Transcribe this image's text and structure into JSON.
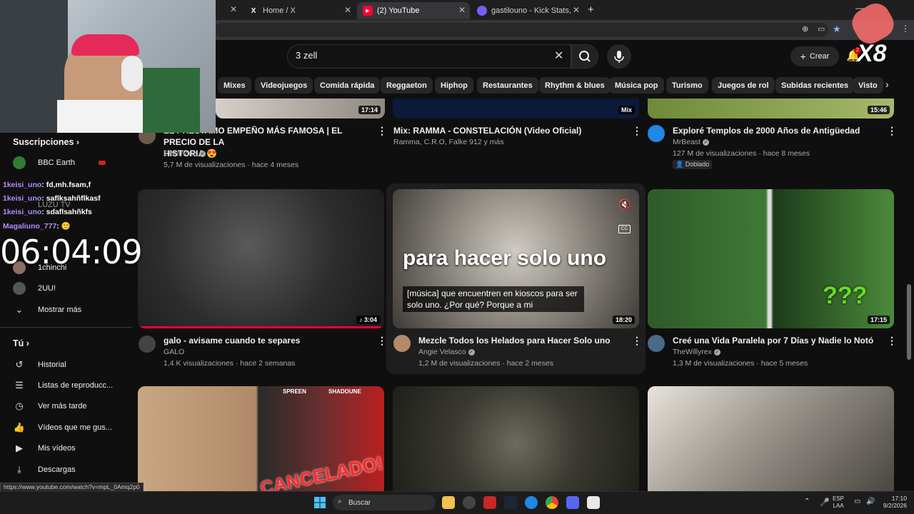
{
  "browser": {
    "tabs": [
      {
        "label": "Home / X"
      },
      {
        "label": "(2) YouTube"
      },
      {
        "label": "gastilouno - Kick Stats, Analytic"
      }
    ],
    "status_url": "https://www.youtube.com/watch?v=mpL_0Amq2p0"
  },
  "header": {
    "search_value": "3 zell",
    "create_label": "Crear",
    "notif_count": "2"
  },
  "chips": [
    "Mixes",
    "Videojuegos",
    "Comida rápida",
    "Reggaeton",
    "Hiphop",
    "Restaurantes",
    "Rhythm & blues",
    "Música pop",
    "Turismo",
    "Juegos de rol",
    "Subidas recientes",
    "Visto"
  ],
  "sidebar": {
    "subs_title": "Suscripciones",
    "subs": [
      {
        "label": "BBC Earth"
      },
      {
        "label": "LUZU TV"
      },
      {
        "label": "1chinchi"
      },
      {
        "label": "2UU!"
      }
    ],
    "show_more": "Mostrar más",
    "you_title": "Tú",
    "you_items": [
      {
        "label": "Historial",
        "icon": "history-icon"
      },
      {
        "label": "Listas de reproducc...",
        "icon": "playlist-icon"
      },
      {
        "label": "Ver más tarde",
        "icon": "clock-icon"
      },
      {
        "label": "Vídeos que me gus...",
        "icon": "thumbs-up-icon"
      },
      {
        "label": "Mis vídeos",
        "icon": "my-videos-icon"
      },
      {
        "label": "Descargas",
        "icon": "download-icon"
      }
    ]
  },
  "overlay": {
    "chat": [
      {
        "user": "1keisi_uno",
        "msg": ": fd,mh.fsam,f"
      },
      {
        "user": "1keisi_uno",
        "msg": ": saflksahñflkasf"
      },
      {
        "user": "1keisi_uno",
        "msg": ": sdaflsahñkfs"
      },
      {
        "user": "Magaliuno_777",
        "msg": ": 🙂"
      }
    ],
    "timer": "06:04:09",
    "multiplier": "X8"
  },
  "videos": [
    {
      "title": "EL PRESTAMO EMPEÑO MÁS FAMOSA | EL PRECIO DE LA",
      "title2": "HISTORIA 😍",
      "channel": "ElMariana",
      "meta": "5,7 M de visualizaciones · hace 4 meses",
      "duration": "17:14"
    },
    {
      "title": "Mix: RAMMA - CONSTELACIÓN (Video Oficial)",
      "channel": "Ramma, C.R.O, Falke 912 y más",
      "meta": "",
      "duration": "Mix"
    },
    {
      "title": "Exploré Templos de 2000 Años de Antigüedad",
      "channel": "MrBeast",
      "meta": "127 M de visualizaciones · hace 8 meses",
      "badge": "Doblado",
      "duration": "15:46"
    },
    {
      "title": "galo - avisame cuando te separes",
      "channel": "GALO",
      "meta": "1,4 K visualizaciones · hace 2 semanas",
      "duration": "3:04"
    },
    {
      "title": "Mezcle Todos los Helados para Hacer Solo uno",
      "channel": "Angie Velasco",
      "meta": "1,2 M de visualizaciones · hace 2 meses",
      "duration": "18:20",
      "thumb_text": "para hacer solo uno",
      "caption": "[música] que encuentren en kioscos para ser solo uno. ¿Por qué? Porque a mi"
    },
    {
      "title": "Creé una Vida Paralela por 7 Días y Nadie lo Notó",
      "channel": "TheWillyrex",
      "meta": "1,3 M de visualizaciones · hace 5 meses",
      "duration": "17:15",
      "thumb_text": "???"
    },
    {
      "thumb_text": "CANCELADO!",
      "label_a": "SPREEN",
      "label_b": "SHADOUNE"
    }
  ],
  "taskbar": {
    "search_label": "Buscar",
    "lang": "ESP",
    "lang2": "LAA",
    "time": "17:10",
    "date": "9/2/2026"
  },
  "colors": {
    "chat_user": "#b58cff",
    "accent_red": "#ff0033",
    "bg": "#0f0f0f"
  }
}
